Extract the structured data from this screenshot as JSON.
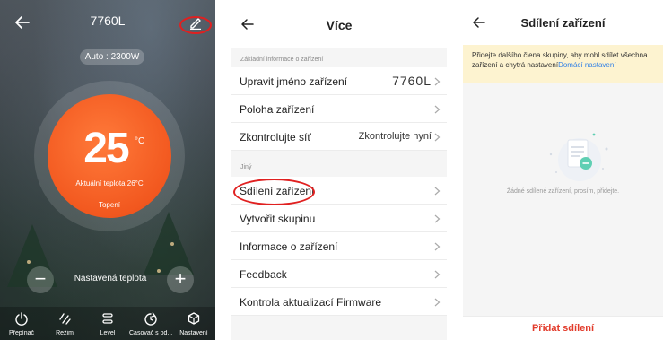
{
  "thermostat": {
    "title": "7760L",
    "mode_badge": "Auto : 2300W",
    "temperature": "25",
    "temperature_unit": "°C",
    "current_temp_label": "Aktuální teplota 26°C",
    "status": "Topení",
    "set_temp_label": "Nastavená teplota",
    "minus_label": "−",
    "plus_label": "+",
    "accent_color": "#f2581f",
    "bottom_nav": [
      {
        "label": "Přepínač",
        "icon": "power-icon"
      },
      {
        "label": "Režim",
        "icon": "mode-icon"
      },
      {
        "label": "Level",
        "icon": "level-icon"
      },
      {
        "label": "Časovač s od...",
        "icon": "timer-icon"
      },
      {
        "label": "Nastavení",
        "icon": "settings-icon"
      }
    ]
  },
  "more": {
    "title": "Více",
    "section_basic": "Základní informace o zařízení",
    "section_other": "Jiný",
    "rows": [
      {
        "label": "Upravit jméno zařízení",
        "value": "7760L"
      },
      {
        "label": "Poloha zařízení",
        "value": ""
      },
      {
        "label": "Zkontrolujte síť",
        "value": "Zkontrolujte nyní"
      },
      {
        "label": "Sdílení zařízení",
        "value": ""
      },
      {
        "label": "Vytvořit skupinu",
        "value": ""
      },
      {
        "label": "Informace o zařízení",
        "value": ""
      },
      {
        "label": "Feedback",
        "value": ""
      },
      {
        "label": "Kontrola aktualizací Firmware",
        "value": ""
      }
    ]
  },
  "share": {
    "title": "Sdílení zařízení",
    "notice_text": "Přidejte dalšího člena skupiny, aby mohl sdílet všechna zařízení a chytrá nastavení",
    "notice_link": "Domácí nastavení",
    "empty_text": "Žádné sdílené zařízení, prosím, přidejte.",
    "add_button": "Přidat sdílení",
    "accent_color": "#e23b2b",
    "link_color": "#2f7fe6"
  }
}
